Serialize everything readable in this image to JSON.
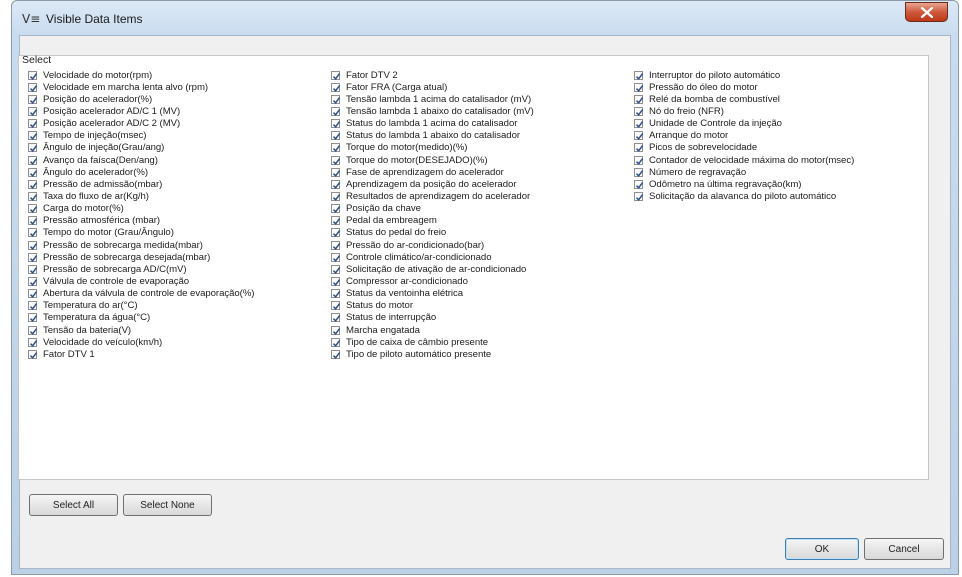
{
  "window": {
    "icon": "list-filter-icon",
    "icon_glyph": "V≡",
    "title": "Visible Data Items",
    "close_icon": "close-icon"
  },
  "group": {
    "label": "Select"
  },
  "columns": [
    [
      {
        "label": "Velocidade do motor(rpm)",
        "checked": true
      },
      {
        "label": "Velocidade em marcha lenta alvo (rpm)",
        "checked": true
      },
      {
        "label": "Posição do acelerador(%)",
        "checked": true
      },
      {
        "label": "Posição acelerador AD/C 1 (MV)",
        "checked": true
      },
      {
        "label": "Posição acelerador AD/C 2 (MV)",
        "checked": true
      },
      {
        "label": "Tempo de injeção(msec)",
        "checked": true
      },
      {
        "label": "Ângulo de injeção(Grau/ang)",
        "checked": true
      },
      {
        "label": "Avanço da faísca(Den/ang)",
        "checked": true
      },
      {
        "label": "Ângulo do acelerador(%)",
        "checked": true
      },
      {
        "label": "Pressão de admissão(mbar)",
        "checked": true
      },
      {
        "label": "Taxa do fluxo de ar(Kg/h)",
        "checked": true
      },
      {
        "label": "Carga do motor(%)",
        "checked": true
      },
      {
        "label": "Pressão atmosférica (mbar)",
        "checked": true
      },
      {
        "label": "Tempo do motor (Grau/Ângulo)",
        "checked": true
      },
      {
        "label": "Pressão de sobrecarga medida(mbar)",
        "checked": true
      },
      {
        "label": "Pressão de sobrecarga desejada(mbar)",
        "checked": true
      },
      {
        "label": "Pressão de sobrecarga AD/C(mV)",
        "checked": true
      },
      {
        "label": "Válvula de controle de evaporação",
        "checked": true
      },
      {
        "label": "Abertura da válvula de controle de evaporação(%)",
        "checked": true
      },
      {
        "label": "Temperatura do ar(°C)",
        "checked": true
      },
      {
        "label": "Temperatura da água(°C)",
        "checked": true
      },
      {
        "label": "Tensão da bateria(V)",
        "checked": true
      },
      {
        "label": "Velocidade do veículo(km/h)",
        "checked": true
      },
      {
        "label": "Fator DTV 1",
        "checked": true
      }
    ],
    [
      {
        "label": "Fator DTV 2",
        "checked": true
      },
      {
        "label": "Fator FRA (Carga atual)",
        "checked": true
      },
      {
        "label": "Tensão lambda 1 acima do catalisador (mV)",
        "checked": true
      },
      {
        "label": "Tensão lambda 1 abaixo do catalisador (mV)",
        "checked": true
      },
      {
        "label": "Status do lambda 1 acima do catalisador",
        "checked": true
      },
      {
        "label": "Status do lambda 1 abaixo do catalisador",
        "checked": true
      },
      {
        "label": "Torque do motor(medido)(%)",
        "checked": true
      },
      {
        "label": "Torque do motor(DESEJADO)(%)",
        "checked": true
      },
      {
        "label": "Fase de aprendizagem do acelerador",
        "checked": true
      },
      {
        "label": "Aprendizagem da posição do acelerador",
        "checked": true
      },
      {
        "label": "Resultados de aprendizagem do acelerador",
        "checked": true
      },
      {
        "label": "Posição da chave",
        "checked": true
      },
      {
        "label": "Pedal da embreagem",
        "checked": true
      },
      {
        "label": "Status do pedal do freio",
        "checked": true
      },
      {
        "label": "Pressão do ar-condicionado(bar)",
        "checked": true
      },
      {
        "label": "Controle climático/ar-condicionado",
        "checked": true
      },
      {
        "label": "Solicitação de ativação de ar-condicionado",
        "checked": true
      },
      {
        "label": "Compressor ar-condicionado",
        "checked": true
      },
      {
        "label": "Status da ventoinha elétrica",
        "checked": true
      },
      {
        "label": "Status do motor",
        "checked": true
      },
      {
        "label": "Status de interrupção",
        "checked": true
      },
      {
        "label": "Marcha engatada",
        "checked": true
      },
      {
        "label": "Tipo de caixa de câmbio presente",
        "checked": true
      },
      {
        "label": "Tipo de piloto automático presente",
        "checked": true
      }
    ],
    [
      {
        "label": "Interruptor do piloto automático",
        "checked": true
      },
      {
        "label": "Pressão do óleo do motor",
        "checked": true
      },
      {
        "label": "Relé da bomba de combustível",
        "checked": true
      },
      {
        "label": "Nó do freio (NFR)",
        "checked": true
      },
      {
        "label": "Unidade de Controle da injeção",
        "checked": true
      },
      {
        "label": "Arranque do motor",
        "checked": true
      },
      {
        "label": "Picos de sobrevelocidade",
        "checked": true
      },
      {
        "label": "Contador de velocidade máxima do motor(msec)",
        "checked": true
      },
      {
        "label": "Número de regravação",
        "checked": true
      },
      {
        "label": "Odômetro na última regravação(km)",
        "checked": true
      },
      {
        "label": "Solicitação da alavanca do piloto automático",
        "checked": true
      }
    ]
  ],
  "buttons": {
    "select_all": "Select All",
    "select_none": "Select None",
    "ok": "OK",
    "cancel": "Cancel"
  }
}
